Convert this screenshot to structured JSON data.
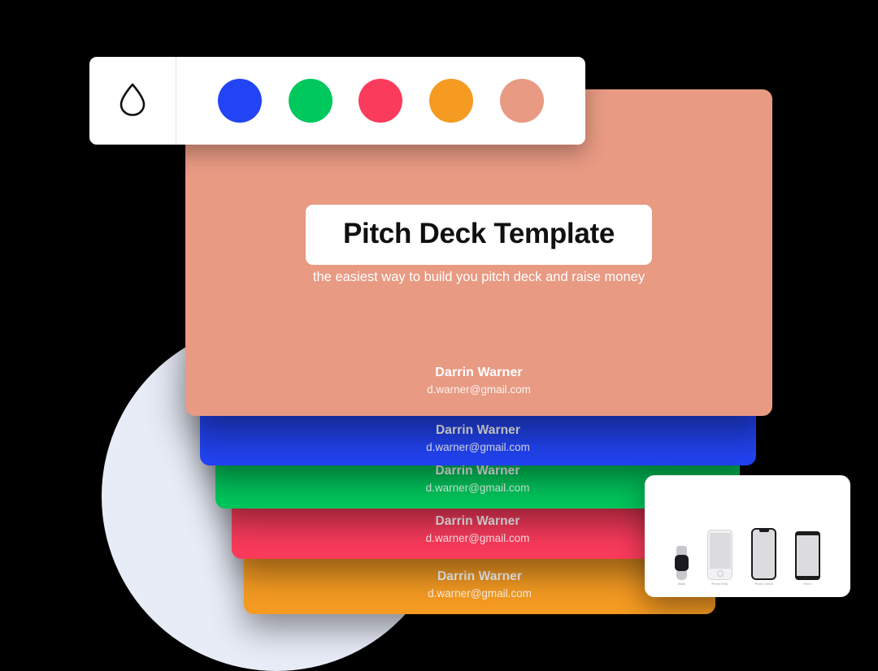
{
  "toolbar": {
    "drop_icon": "water-drop-icon",
    "swatches": [
      {
        "name": "blue",
        "color": "#2244f5",
        "selected": false
      },
      {
        "name": "green",
        "color": "#00c85c",
        "selected": false
      },
      {
        "name": "red",
        "color": "#fb3b5c",
        "selected": false
      },
      {
        "name": "orange",
        "color": "#f59b22",
        "selected": false
      },
      {
        "name": "salmon",
        "color": "#e89a83",
        "selected": true
      }
    ]
  },
  "main_slide": {
    "background": "#e89a83",
    "title": "Pitch Deck Template",
    "subtitle": "the easiest way to build you pitch deck and raise money",
    "author_name": "Darrin Warner",
    "author_email": "d.warner@gmail.com"
  },
  "stacked_slides": [
    {
      "color_name": "blue",
      "color": "#2244f5",
      "author_name": "Darrin Warner",
      "author_email": "d.warner@gmail.com"
    },
    {
      "color_name": "green",
      "color": "#00c85c",
      "author_name": "Darrin Warner",
      "author_email": "d.warner@gmail.com"
    },
    {
      "color_name": "red",
      "color": "#fb3b5c",
      "author_name": "Darrin Warner",
      "author_email": "d.warner@gmail.com"
    },
    {
      "color_name": "orange",
      "color": "#f59b22",
      "author_name": "Darrin Warner",
      "author_email": "d.warner@gmail.com"
    }
  ],
  "device_panel": {
    "devices": [
      {
        "name": "watch",
        "label": "Watch"
      },
      {
        "name": "iphone-8",
        "label": "iPhone 8/7/6s"
      },
      {
        "name": "iphone-x",
        "label": "iPhone 11/Xs/X"
      },
      {
        "name": "pixel-3",
        "label": "Pixel 3"
      }
    ]
  },
  "decor": {
    "blob_color": "#e8ecf7"
  }
}
